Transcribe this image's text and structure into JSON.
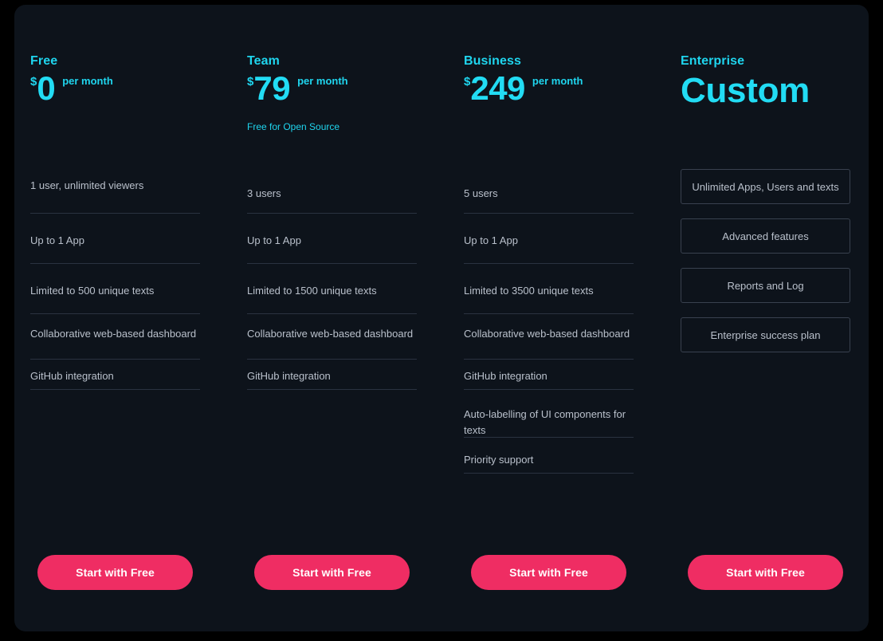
{
  "theme": {
    "outer_background": "#000000",
    "panel_background": "#0d131b",
    "accent_cyan": "#22dcf4",
    "accent_pink": "#ef2d63",
    "feature_text": "#b9c0cb",
    "divider": "#2a3240",
    "box_border": "#39414f"
  },
  "plans": [
    {
      "name": "Free",
      "currency": "$",
      "amount": "0",
      "period": "per month",
      "note": "",
      "features": [
        "1 user, unlimited viewers",
        "Up to 1 App",
        "Limited to 500 unique texts",
        "Collaborative web-based dashboard",
        "GitHub integration"
      ],
      "cta_label": "Start with Free"
    },
    {
      "name": "Team",
      "currency": "$",
      "amount": "79",
      "period": "per month",
      "note": "Free for Open Source",
      "features": [
        "3 users",
        "Up to 1 App",
        "Limited to 1500 unique texts",
        "Collaborative web-based dashboard",
        "GitHub integration"
      ],
      "cta_label": "Start with Free"
    },
    {
      "name": "Business",
      "currency": "$",
      "amount": "249",
      "period": "per month",
      "note": "",
      "features": [
        "5 users",
        "Up to 1 App",
        "Limited to 3500 unique texts",
        "Collaborative web-based dashboard",
        "GitHub integration",
        "Auto-labelling of UI components for texts",
        "Priority support"
      ],
      "cta_label": "Start with Free"
    },
    {
      "name": "Enterprise",
      "currency": "",
      "amount": "Custom",
      "period": "",
      "note": "",
      "boxed_features": [
        "Unlimited Apps, Users and texts",
        "Advanced features",
        "Reports and Log",
        "Enterprise success plan"
      ],
      "cta_label": "Start with Free"
    }
  ]
}
